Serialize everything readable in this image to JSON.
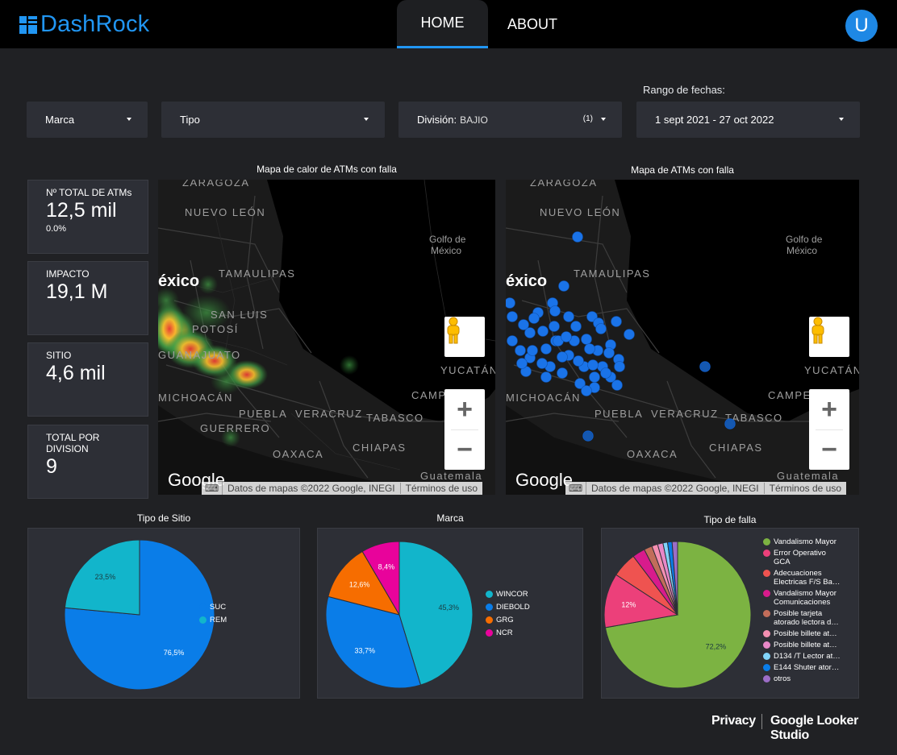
{
  "app": {
    "name": "DashRock"
  },
  "nav": {
    "tabs": [
      {
        "label": "HOME"
      },
      {
        "label": "ABOUT"
      }
    ],
    "avatar_initial": "U"
  },
  "filters": {
    "marca": "Marca",
    "tipo": "Tipo",
    "division_label": "División:",
    "division_value": "BAJIO",
    "division_count": "(1)",
    "date_range_label": "Rango de fechas:",
    "date_range": "1 sept 2021 - 27 oct 2022"
  },
  "kpis": [
    {
      "label": "Nº TOTAL DE ATMs",
      "value": "12,5 mil",
      "sub": "0.0%"
    },
    {
      "label": "IMPACTO",
      "value": "19,1 M"
    },
    {
      "label": "SITIO",
      "value": "4,6 mil"
    },
    {
      "label": "TOTAL POR DIVISION",
      "value": "9"
    }
  ],
  "maps": {
    "heat_title": "Mapa de calor de ATMs con falla",
    "points_title": "Mapa de ATMs con falla",
    "google": "Google",
    "attribution": "Datos de mapas ©2022 Google, INEGI",
    "terms": "Términos de uso",
    "places": [
      "ZARAGOZA",
      "NUEVO LEÓN",
      "TAMAULIPAS",
      "Golfo de",
      "México",
      "éxico",
      "SAN LUIS",
      "POTOSÍ",
      "GUANAJUATO",
      "YUCATÁN",
      "MICHOACÁN",
      "PUEBLA",
      "VERACRUZ",
      "TABASCO",
      "CAMPECHE",
      "GUERRERO",
      "OAXACA",
      "CHIAPAS",
      "Guatemala"
    ]
  },
  "charts": {
    "tipo_sitio_title": "Tipo de Sitio",
    "marca_title": "Marca",
    "tipo_falla_title": "Tipo de falla"
  },
  "chart_data": [
    {
      "type": "pie",
      "title": "Tipo de Sitio",
      "categories": [
        "SUC",
        "REM"
      ],
      "values": [
        76.5,
        23.5
      ],
      "labels": [
        "76,5%",
        "23,5%"
      ],
      "colors": [
        "#0a7de8",
        "#12b5cb"
      ]
    },
    {
      "type": "pie",
      "title": "Marca",
      "categories": [
        "WINCOR",
        "DIEBOLD",
        "GRG",
        "NCR"
      ],
      "values": [
        45.3,
        33.7,
        12.6,
        8.4
      ],
      "labels": [
        "45,3%",
        "33,7%",
        "12,6%",
        "8,4%"
      ],
      "colors": [
        "#12b5cb",
        "#0a7de8",
        "#f66d00",
        "#e8039b"
      ]
    },
    {
      "type": "pie",
      "title": "Tipo de falla",
      "categories": [
        "Vandalismo Mayor",
        "Error Operativo GCA",
        "Adecuaciones Electricas F/S Ba…",
        "Vandalismo Mayor Comunicaciones",
        "Posible tarjeta atorado lectora d…",
        "Posible billete at…",
        "Posible billete at…",
        "D134 /T Lector at…",
        "E144 Shuter ator…",
        "otros"
      ],
      "values": [
        72.2,
        12,
        5.5,
        2.8,
        1.8,
        1.3,
        1.2,
        1,
        1,
        1.2
      ],
      "labels": [
        "72,2%",
        "12%",
        "",
        "",
        "",
        "",
        "",
        "",
        "",
        ""
      ],
      "colors": [
        "#7cb342",
        "#ec407a",
        "#ef5350",
        "#d81b8c",
        "#c26d5a",
        "#f48fb1",
        "#e888c8",
        "#81d4fa",
        "#0a7de8",
        "#9c6dc7"
      ]
    }
  ]
}
